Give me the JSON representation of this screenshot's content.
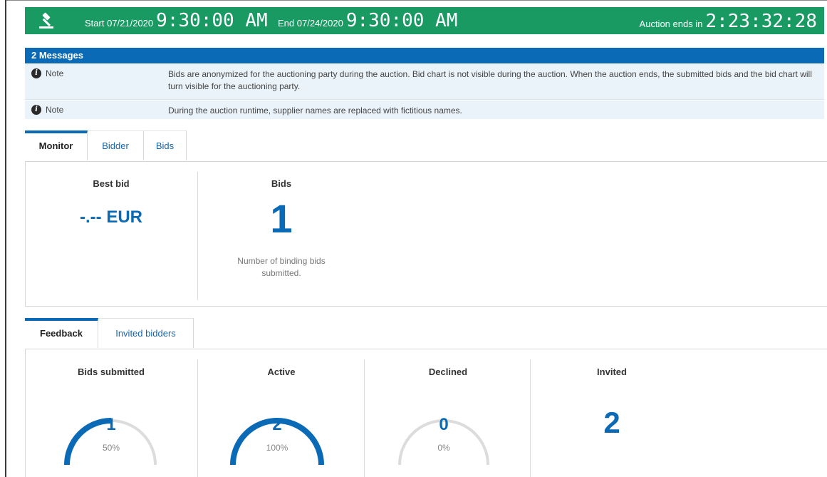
{
  "header": {
    "start_label": "Start 07/21/2020",
    "start_time": "9:30:00 AM",
    "end_label": "End 07/24/2020",
    "end_time": "9:30:00 AM",
    "ends_label": "Auction ends in",
    "countdown": "2:23:32:28",
    "icon": "gavel-icon",
    "color": "#1a9a63"
  },
  "messages": {
    "title": "2 Messages",
    "items": [
      {
        "type": "Note",
        "text": "Bids are anonymized for the auctioning party during the auction. Bid chart is not visible during the auction. When the auction ends, the submitted bids and the bid chart will turn visible for the auctioning party."
      },
      {
        "type": "Note",
        "text": "During the auction runtime, supplier names are replaced with fictitious names."
      }
    ],
    "header_color": "#0b6ab5"
  },
  "monitor_tabs": [
    {
      "label": "Monitor",
      "active": true
    },
    {
      "label": "Bidder",
      "active": false
    },
    {
      "label": "Bids",
      "active": false
    }
  ],
  "monitor": {
    "best_bid_label": "Best bid",
    "best_bid_value": "-.-- EUR",
    "bids_label": "Bids",
    "bids_value": "1",
    "bids_caption": "Number of binding bids submitted."
  },
  "feedback_tabs": [
    {
      "label": "Feedback",
      "active": true
    },
    {
      "label": "Invited bidders",
      "active": false
    }
  ],
  "feedback": {
    "cards": [
      {
        "label": "Bids submitted",
        "value": "1",
        "percent_text": "50%",
        "fraction": 0.5
      },
      {
        "label": "Active",
        "value": "2",
        "percent_text": "100%",
        "fraction": 1.0
      },
      {
        "label": "Declined",
        "value": "0",
        "percent_text": "0%",
        "fraction": 0.0
      }
    ],
    "invited_label": "Invited",
    "invited_value": "2"
  },
  "accent_color": "#0b6ab5"
}
